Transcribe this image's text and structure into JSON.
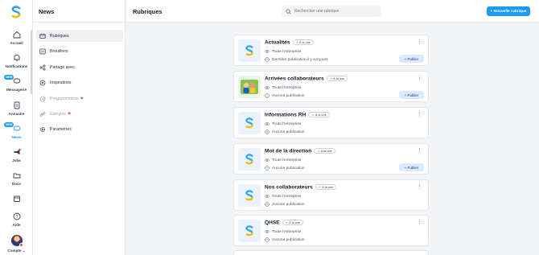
{
  "rail": {
    "items": [
      {
        "label": "Accueil",
        "icon": "home-icon"
      },
      {
        "label": "Notifications",
        "icon": "bell-icon"
      },
      {
        "label": "Messagerie",
        "icon": "chat-icon",
        "badge": "NEW"
      },
      {
        "label": "Annuaire",
        "icon": "directory-icon"
      },
      {
        "label": "News",
        "icon": "news-icon",
        "badge": "NEW",
        "active": true
      },
      {
        "label": "Jobs",
        "icon": "megaphone-icon"
      },
      {
        "label": "Docs",
        "icon": "folder-icon"
      },
      {
        "label": "",
        "icon": "calendar-icon"
      },
      {
        "label": "Aide",
        "icon": "help-icon"
      },
      {
        "label": "Compte ⌄",
        "icon": "avatar"
      }
    ]
  },
  "subnav": {
    "title": "News",
    "items": [
      {
        "label": "Rubriques",
        "icon": "folder-icon",
        "active": true
      },
      {
        "label": "Brouillons",
        "icon": "draft-icon"
      },
      {
        "label": "Partagé avec",
        "icon": "share-icon"
      },
      {
        "label": "Inspirations",
        "icon": "inspiration-icon"
      },
      {
        "label": "Programmation",
        "icon": "clock-icon",
        "disabled": true
      },
      {
        "label": "Épinglés",
        "icon": "link-icon",
        "disabled": true
      },
      {
        "label": "Paramètres",
        "icon": "gear-icon"
      }
    ]
  },
  "header": {
    "title": "Rubriques",
    "search_placeholder": "Rechercher une rubrique",
    "new_button": "+ Nouvelle rubrique"
  },
  "cards": [
    {
      "title": "Actualités",
      "tag": "À la une",
      "audience": "Toute l'entreprise",
      "status": "Dernière publication il y a 6 jours",
      "publish": "+ Publier",
      "thumb": "logo"
    },
    {
      "title": "Arrivées collaborateurs",
      "tag": "À la une",
      "audience": "Toute l'entreprise",
      "status": "Aucune publication",
      "publish": "+ Publier",
      "thumb": "photo"
    },
    {
      "title": "Informations RH",
      "tag": "À la une",
      "audience": "Toute l'entreprise",
      "status": "Aucune publication",
      "thumb": "logo"
    },
    {
      "title": "Mot de la direction",
      "tag": "À la une",
      "audience": "Toute l'entreprise",
      "status": "Aucune publication",
      "publish": "+ Publier",
      "thumb": "logo"
    },
    {
      "title": "Nos collaborateurs",
      "tag": "À la une",
      "audience": "Toute l'entreprise",
      "status": "Aucune publication",
      "thumb": "logo"
    },
    {
      "title": "QHSE",
      "tag": "À la une",
      "audience": "Toute l'entreprise",
      "status": "Aucune publication",
      "thumb": "logo"
    }
  ],
  "colors": {
    "accent": "#1d9bf0",
    "logo_blue": "#2ea3f2",
    "logo_yellow": "#f7b500"
  }
}
